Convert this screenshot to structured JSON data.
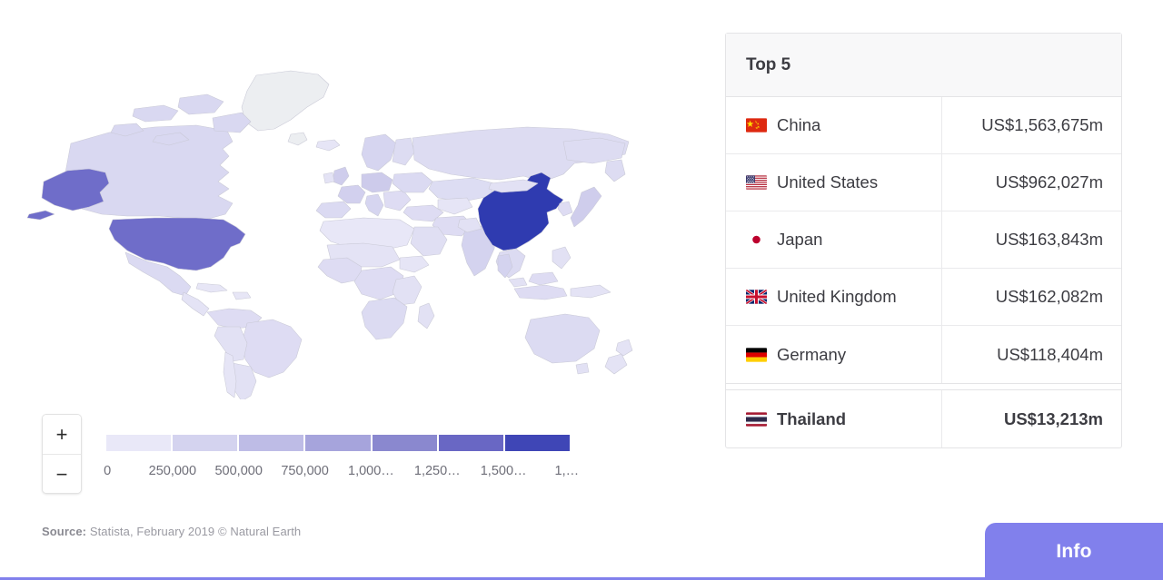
{
  "map": {
    "title_alt": "World map choropleth",
    "zoom_in_label": "+",
    "zoom_out_label": "−",
    "highlight_country": "China",
    "colors": {
      "no_data": "#eceef1",
      "ocean": "#ffffff",
      "border": "#c9c9d6",
      "accent_purple": "#8180ec",
      "scale_min": "#e9e8f8",
      "scale_max": "#2f3bb0"
    }
  },
  "legend": {
    "swatches": [
      "#e9e8f8",
      "#d4d3ef",
      "#bebce6",
      "#a6a4dc",
      "#8a88cf",
      "#6967c4",
      "#3f46b6"
    ],
    "ticks": [
      "0",
      "250,000",
      "500,000",
      "750,000",
      "1,000…",
      "1,250…",
      "1,500…",
      "1,…"
    ]
  },
  "source": {
    "label": "Source:",
    "text": " Statista, February 2019 © Natural Earth"
  },
  "top5": {
    "title": "Top 5",
    "rows": [
      {
        "flag": "cn-flag",
        "name": "China",
        "value": "US$1,563,675m"
      },
      {
        "flag": "us-flag",
        "name": "United States",
        "value": "US$962,027m"
      },
      {
        "flag": "jp-flag",
        "name": "Japan",
        "value": "US$163,843m"
      },
      {
        "flag": "gb-flag",
        "name": "United Kingdom",
        "value": "US$162,082m"
      },
      {
        "flag": "de-flag",
        "name": "Germany",
        "value": "US$118,404m"
      }
    ],
    "highlight": {
      "flag": "th-flag",
      "name": "Thailand",
      "value": "US$13,213m"
    }
  },
  "info_button": {
    "label": "Info"
  },
  "chart_data": {
    "type": "map",
    "title": "Top 5",
    "unit": "US$ million",
    "categories": [
      "China",
      "United States",
      "Japan",
      "United Kingdom",
      "Germany",
      "Thailand"
    ],
    "values": [
      1563675,
      962027,
      163843,
      162082,
      118404,
      13213
    ],
    "value_labels": [
      "US$1,563,675m",
      "US$962,027m",
      "US$163,843m",
      "US$162,082m",
      "US$118,404m",
      "US$13,213m"
    ],
    "highlighted": "Thailand",
    "colorbar": {
      "ticks": [
        "0",
        "250,000",
        "500,000",
        "750,000",
        "1,000…",
        "1,250…",
        "1,500…",
        "1,…"
      ],
      "tick_values": [
        0,
        250000,
        500000,
        750000,
        1000000,
        1250000,
        1500000,
        1750000
      ],
      "bands": 7,
      "range": [
        0,
        1750000
      ]
    },
    "source": "Statista, February 2019 © Natural Earth",
    "legend_position": "bottom-left"
  }
}
